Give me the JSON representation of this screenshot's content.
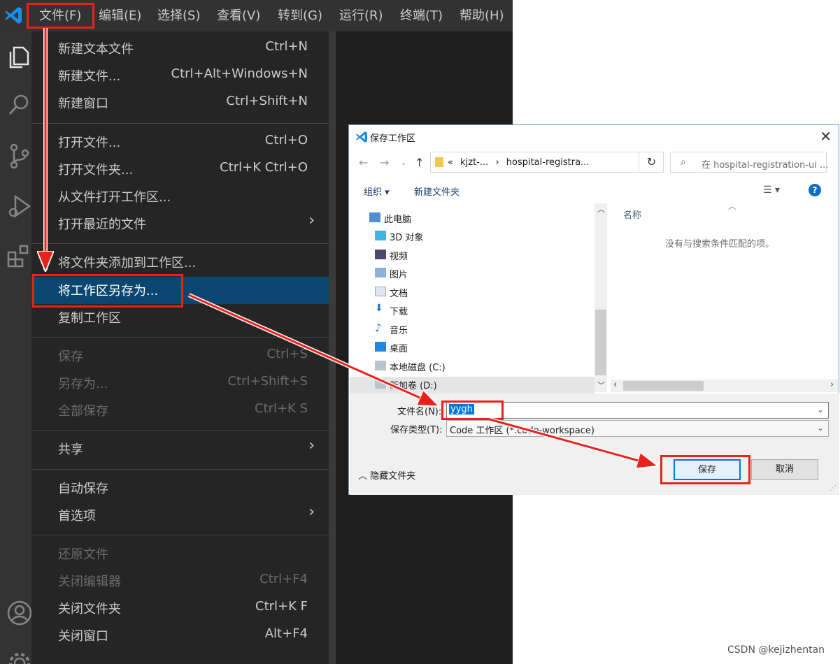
{
  "menubar": {
    "items": [
      "文件(F)",
      "编辑(E)",
      "选择(S)",
      "查看(V)",
      "转到(G)",
      "运行(R)",
      "终端(T)",
      "帮助(H)"
    ]
  },
  "file_menu": {
    "items": [
      {
        "label": "新建文本文件",
        "shortcut": "Ctrl+N"
      },
      {
        "label": "新建文件...",
        "shortcut": "Ctrl+Alt+Windows+N"
      },
      {
        "label": "新建窗口",
        "shortcut": "Ctrl+Shift+N"
      },
      {
        "label": "打开文件...",
        "shortcut": "Ctrl+O"
      },
      {
        "label": "打开文件夹...",
        "shortcut": "Ctrl+K Ctrl+O"
      },
      {
        "label": "从文件打开工作区...",
        "shortcut": ""
      },
      {
        "label": "打开最近的文件",
        "shortcut": ""
      },
      {
        "label": "将文件夹添加到工作区...",
        "shortcut": ""
      },
      {
        "label": "将工作区另存为...",
        "shortcut": ""
      },
      {
        "label": "复制工作区",
        "shortcut": ""
      },
      {
        "label": "保存",
        "shortcut": "Ctrl+S"
      },
      {
        "label": "另存为...",
        "shortcut": "Ctrl+Shift+S"
      },
      {
        "label": "全部保存",
        "shortcut": "Ctrl+K S"
      },
      {
        "label": "共享",
        "shortcut": ""
      },
      {
        "label": "自动保存",
        "shortcut": ""
      },
      {
        "label": "首选项",
        "shortcut": ""
      },
      {
        "label": "还原文件",
        "shortcut": ""
      },
      {
        "label": "关闭编辑器",
        "shortcut": "Ctrl+F4"
      },
      {
        "label": "关闭文件夹",
        "shortcut": "Ctrl+K F"
      },
      {
        "label": "关闭窗口",
        "shortcut": "Alt+F4"
      }
    ]
  },
  "dialog": {
    "title": "保存工作区",
    "close": "✕",
    "breadcrumb_prefix": "«",
    "breadcrumb_1": "kjzt-...",
    "breadcrumb_sep": "›",
    "breadcrumb_2": "hospital-registra...",
    "search_placeholder": "在 hospital-registration-ui ...",
    "organize": "组织 ▾",
    "new_folder": "新建文件夹",
    "nav_items": [
      "此电脑",
      "3D 对象",
      "视频",
      "图片",
      "文档",
      "下载",
      "音乐",
      "桌面",
      "本地磁盘 (C:)",
      "新加卷 (D:)"
    ],
    "column_name": "名称",
    "empty_message": "没有与搜索条件匹配的项。",
    "filename_label": "文件名(N):",
    "filename_value": "yygh",
    "filetype_label": "保存类型(T):",
    "filetype_value": "Code 工作区 (*.code-workspace)",
    "hide_folders": "隐藏文件夹",
    "save_button": "保存",
    "cancel_button": "取消"
  },
  "watermark": "CSDN @kejizhentan",
  "colors": {
    "menubar": "#323233",
    "menu_bg": "#252526",
    "selection": "#094771",
    "annotation": "#e8221b",
    "vscode_blue": "#0078d4"
  }
}
